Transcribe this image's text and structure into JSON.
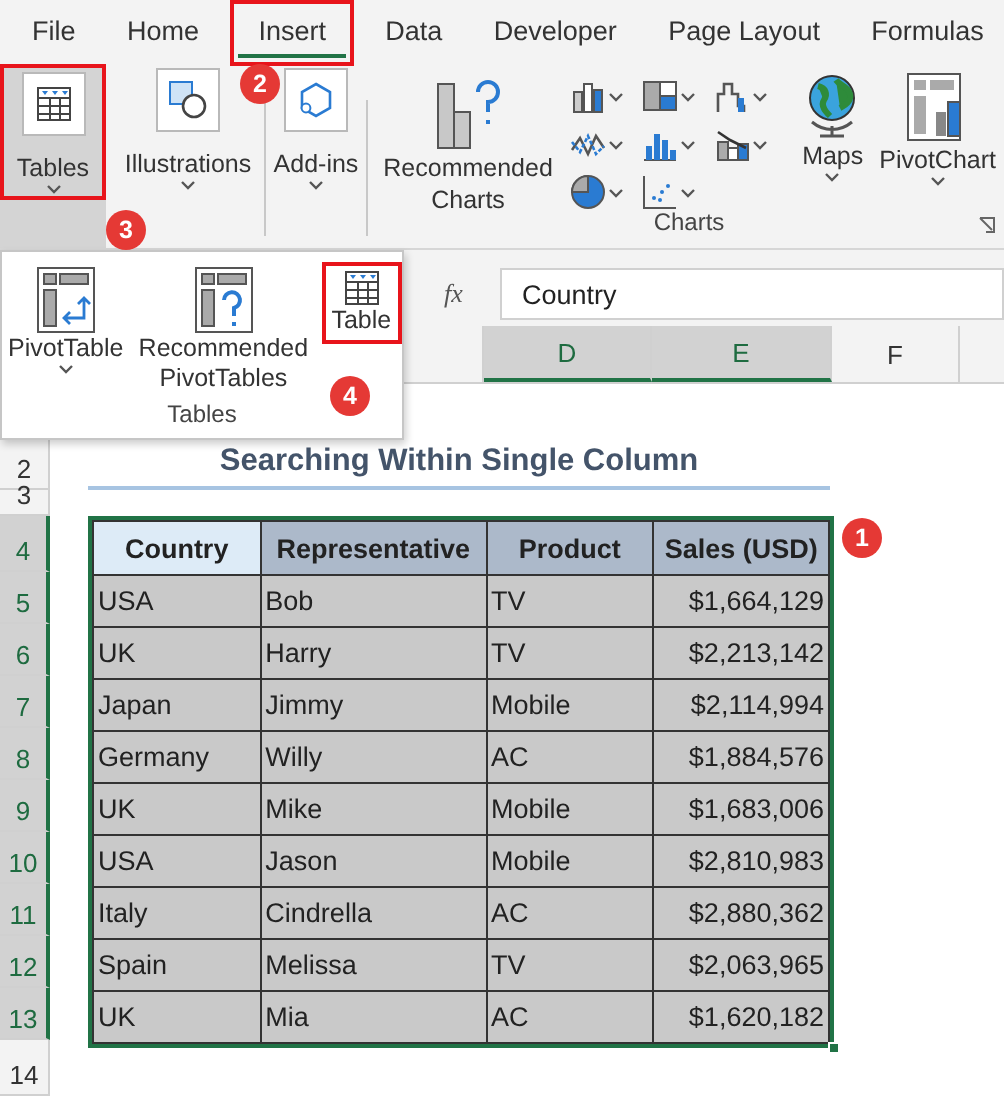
{
  "menu_tabs": [
    {
      "label": "File",
      "selected": false,
      "annotated": false
    },
    {
      "label": "Home",
      "selected": false,
      "annotated": false
    },
    {
      "label": "Insert",
      "selected": true,
      "annotated": true
    },
    {
      "label": "Data",
      "selected": false,
      "annotated": false
    },
    {
      "label": "Developer",
      "selected": false,
      "annotated": false
    },
    {
      "label": "Page Layout",
      "selected": false,
      "annotated": false
    },
    {
      "label": "Formulas",
      "selected": false,
      "annotated": false
    }
  ],
  "ribbon_buttons": [
    {
      "label": "Tables",
      "kind": "table",
      "selected": true,
      "annotated": true
    },
    {
      "label": "Illustrations",
      "kind": "shapes",
      "selected": false,
      "annotated": false
    },
    {
      "label": "Add-ins",
      "kind": "addins",
      "selected": false,
      "annotated": false
    }
  ],
  "charts_group": {
    "label": "Charts",
    "recommended": "Recommended Charts",
    "chart_types": [
      {
        "kind": "column"
      },
      {
        "kind": "treemap"
      },
      {
        "kind": "waterfall"
      },
      {
        "kind": "line"
      },
      {
        "kind": "histogram"
      },
      {
        "kind": "combo"
      },
      {
        "kind": "pie"
      },
      {
        "kind": "scatter"
      }
    ],
    "more_buttons": [
      {
        "label": "Maps",
        "kind": "globe"
      },
      {
        "label": "PivotChart",
        "kind": "pivotchart"
      }
    ]
  },
  "dropdown": {
    "group_label": "Tables",
    "items": [
      {
        "label": "PivotTable",
        "kind": "pivot",
        "caret": true,
        "annotated": false
      },
      {
        "label": "Recommended PivotTables",
        "kind": "recpivot",
        "caret": false,
        "annotated": false
      },
      {
        "label": "Table",
        "kind": "table",
        "caret": false,
        "annotated": true
      }
    ]
  },
  "formula_bar": {
    "function_label": "fx",
    "value": "Country"
  },
  "column_headers": [
    {
      "label": "D",
      "selected": true
    },
    {
      "label": "E",
      "selected": true
    },
    {
      "label": "F",
      "selected": false
    }
  ],
  "row_numbers": [
    {
      "label": "2",
      "selected": false
    },
    {
      "label": "3",
      "selected": false
    },
    {
      "label": "4",
      "selected": true
    },
    {
      "label": "5",
      "selected": true
    },
    {
      "label": "6",
      "selected": true
    },
    {
      "label": "7",
      "selected": true
    },
    {
      "label": "8",
      "selected": true
    },
    {
      "label": "9",
      "selected": true
    },
    {
      "label": "10",
      "selected": true
    },
    {
      "label": "11",
      "selected": true
    },
    {
      "label": "12",
      "selected": true
    },
    {
      "label": "13",
      "selected": true
    },
    {
      "label": "14",
      "selected": false
    }
  ],
  "sheet_title": "Searching Within Single Column",
  "table": {
    "columns": [
      "Country",
      "Representative",
      "Product",
      "Sales (USD)"
    ],
    "rows": [
      [
        "USA",
        "Bob",
        "TV",
        "$1,664,129"
      ],
      [
        "UK",
        "Harry",
        "TV",
        "$2,213,142"
      ],
      [
        "Japan",
        "Jimmy",
        "Mobile",
        "$2,114,994"
      ],
      [
        "Germany",
        "Willy",
        "AC",
        "$1,884,576"
      ],
      [
        "UK",
        "Mike",
        "Mobile",
        "$1,683,006"
      ],
      [
        "USA",
        "Jason",
        "Mobile",
        "$2,810,983"
      ],
      [
        "Italy",
        "Cindrella",
        "AC",
        "$2,880,362"
      ],
      [
        "Spain",
        "Melissa",
        "TV",
        "$2,063,965"
      ],
      [
        "UK",
        "Mia",
        "AC",
        "$1,620,182"
      ]
    ]
  },
  "callouts": [
    {
      "number": "1"
    },
    {
      "number": "2"
    },
    {
      "number": "3"
    },
    {
      "number": "4"
    }
  ]
}
